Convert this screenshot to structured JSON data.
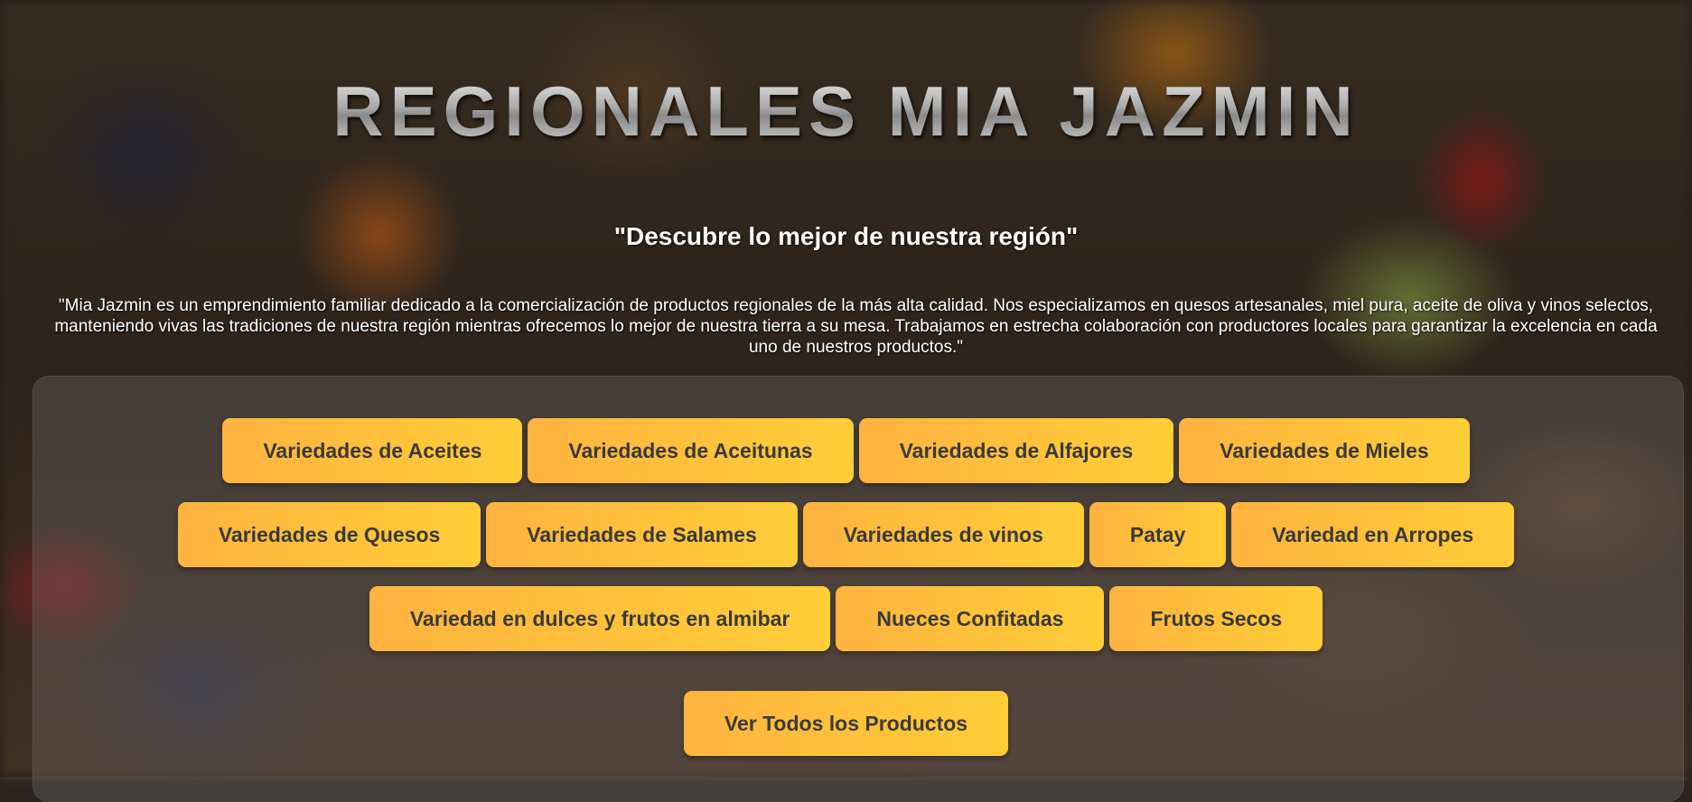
{
  "header": {
    "title": "REGIONALES MIA JAZMIN",
    "tagline": "\"Descubre lo mejor de nuestra región\"",
    "description": "\"Mia Jazmin es un emprendimiento familiar dedicado a la comercialización de productos regionales de la más alta calidad. Nos especializamos en quesos artesanales, miel pura, aceite de oliva y vinos selectos, manteniendo vivas las tradiciones de nuestra región mientras ofrecemos lo mejor de nuestra tierra a su mesa. Trabajamos en estrecha colaboración con productores locales para garantizar la excelencia en cada uno de nuestros productos.\""
  },
  "categories": {
    "row1": [
      "Variedades de Aceites",
      "Variedades de Aceitunas",
      "Variedades de Alfajores",
      "Variedades de Mieles"
    ],
    "row2": [
      "Variedades de Quesos",
      "Variedades de Salames",
      "Variedades de vinos",
      "Patay",
      "Variedad en Arropes"
    ],
    "row3": [
      "Variedad en dulces y frutos en almibar",
      "Nueces Confitadas",
      "Frutos Secos"
    ]
  },
  "cta": {
    "all_products_label": "Ver Todos los Productos"
  },
  "colors": {
    "button_start": "#ffb340",
    "button_end": "#ffcd36",
    "button_text": "#3a3a3a"
  }
}
